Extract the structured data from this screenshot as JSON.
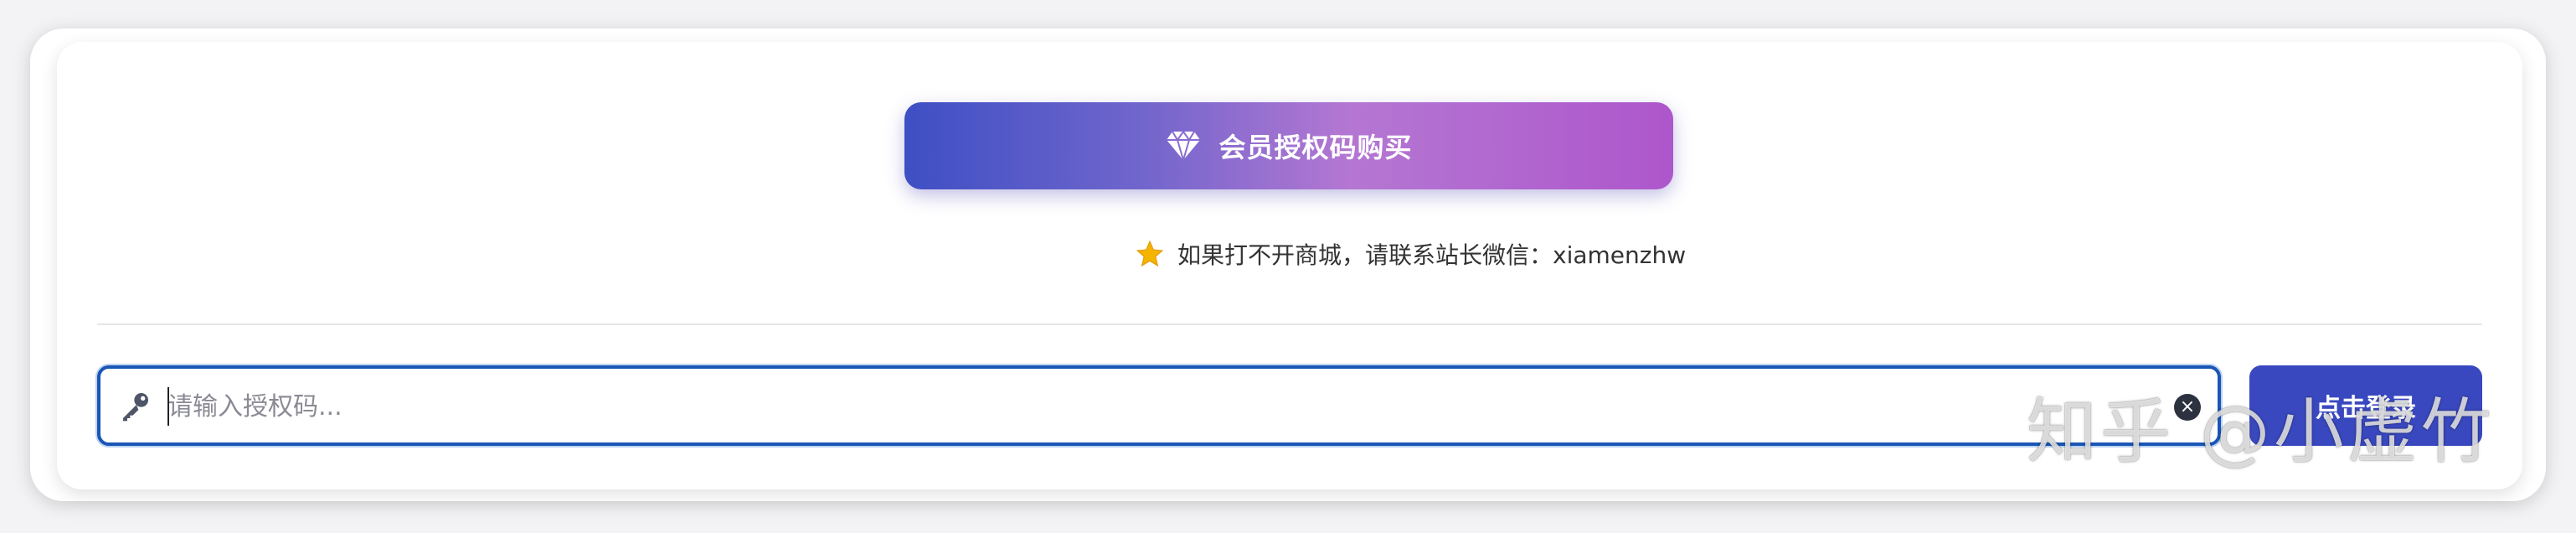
{
  "buy_button": {
    "label": "会员授权码购买",
    "icon": "diamond-icon"
  },
  "notice": {
    "icon": "star-icon",
    "text": "如果打不开商城，请联系站长微信：xiamenzhw"
  },
  "auth_input": {
    "icon": "key-icon",
    "placeholder": "请输入授权码...",
    "value": "",
    "clear_icon": "clear-icon"
  },
  "login_button": {
    "label": "点击登录"
  },
  "watermark": {
    "text": "知乎 @小虚竹"
  },
  "colors": {
    "gradient_start": "#3e4fc4",
    "gradient_end": "#ae56cc",
    "login_button": "#3948bf",
    "input_border": "#1a56b5",
    "star": "#f5b400"
  }
}
